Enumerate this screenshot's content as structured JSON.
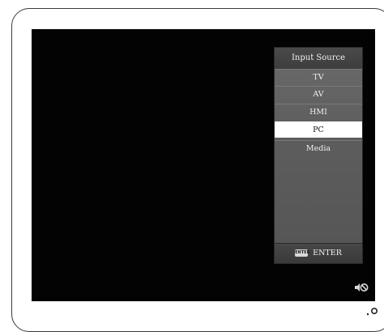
{
  "menu": {
    "title": "Input Source",
    "items": [
      {
        "label": "TV",
        "selected": false
      },
      {
        "label": "AV",
        "selected": false
      },
      {
        "label": "HMI",
        "selected": false
      },
      {
        "label": "PC",
        "selected": true
      },
      {
        "label": "Media",
        "selected": false
      }
    ],
    "footer": {
      "key_label": "ENTER",
      "action_label": "ENTER"
    }
  },
  "icons": {
    "status": "mute-icon",
    "enter_key": "enter-key-icon"
  },
  "colors": {
    "screen": "#030303",
    "menu_bg": "#5d5d5d",
    "selected_bg": "#ffffff",
    "selected_text": "#111111",
    "text": "#f0f0f0"
  }
}
